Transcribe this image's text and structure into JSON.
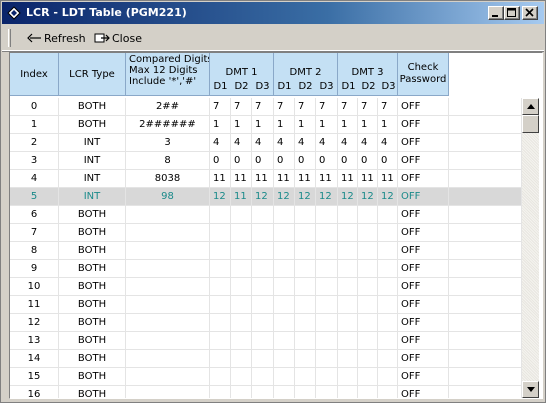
{
  "window": {
    "title": "LCR - LDT Table (PGM221)"
  },
  "toolbar": {
    "refresh_label": "Refresh",
    "refresh_icon": "refresh-arrow-icon",
    "close_label": "Close",
    "close_icon": "close-doc-icon"
  },
  "headers": {
    "index": "Index",
    "lcr_type": "LCR Type",
    "compared_line1": "Compared Digits",
    "compared_line2": "Max 12 Digits",
    "compared_line3": "Include '*','#'",
    "dmt1": "DMT 1",
    "dmt2": "DMT 2",
    "dmt3": "DMT 3",
    "d1": "D1",
    "d2": "D2",
    "d3": "D3",
    "check_line1": "Check",
    "check_line2": "Password"
  },
  "colors": {
    "header_bg": "#c4e0f4",
    "selected_row_bg": "#d8d8d8",
    "selected_row_text": "#1a8a8a",
    "title_gradient_start": "#0a246a"
  },
  "selected_row_index": 5,
  "rows": [
    {
      "index": "0",
      "type": "BOTH",
      "digits": "2##",
      "dmt": [
        "7",
        "7",
        "7",
        "7",
        "7",
        "7",
        "7",
        "7",
        "7"
      ],
      "check": "OFF"
    },
    {
      "index": "1",
      "type": "BOTH",
      "digits": "2######",
      "dmt": [
        "1",
        "1",
        "1",
        "1",
        "1",
        "1",
        "1",
        "1",
        "1"
      ],
      "check": "OFF"
    },
    {
      "index": "2",
      "type": "INT",
      "digits": "3",
      "dmt": [
        "4",
        "4",
        "4",
        "4",
        "4",
        "4",
        "4",
        "4",
        "4"
      ],
      "check": "OFF"
    },
    {
      "index": "3",
      "type": "INT",
      "digits": "8",
      "dmt": [
        "0",
        "0",
        "0",
        "0",
        "0",
        "0",
        "0",
        "0",
        "0"
      ],
      "check": "OFF"
    },
    {
      "index": "4",
      "type": "INT",
      "digits": "8038",
      "dmt": [
        "11",
        "11",
        "11",
        "11",
        "11",
        "11",
        "11",
        "11",
        "11"
      ],
      "check": "OFF"
    },
    {
      "index": "5",
      "type": "INT",
      "digits": "98",
      "dmt": [
        "12",
        "11",
        "12",
        "12",
        "12",
        "12",
        "12",
        "12",
        "12"
      ],
      "check": "OFF"
    },
    {
      "index": "6",
      "type": "BOTH",
      "digits": "",
      "dmt": [
        "",
        "",
        "",
        "",
        "",
        "",
        "",
        "",
        ""
      ],
      "check": "OFF"
    },
    {
      "index": "7",
      "type": "BOTH",
      "digits": "",
      "dmt": [
        "",
        "",
        "",
        "",
        "",
        "",
        "",
        "",
        ""
      ],
      "check": "OFF"
    },
    {
      "index": "8",
      "type": "BOTH",
      "digits": "",
      "dmt": [
        "",
        "",
        "",
        "",
        "",
        "",
        "",
        "",
        ""
      ],
      "check": "OFF"
    },
    {
      "index": "9",
      "type": "BOTH",
      "digits": "",
      "dmt": [
        "",
        "",
        "",
        "",
        "",
        "",
        "",
        "",
        ""
      ],
      "check": "OFF"
    },
    {
      "index": "10",
      "type": "BOTH",
      "digits": "",
      "dmt": [
        "",
        "",
        "",
        "",
        "",
        "",
        "",
        "",
        ""
      ],
      "check": "OFF"
    },
    {
      "index": "11",
      "type": "BOTH",
      "digits": "",
      "dmt": [
        "",
        "",
        "",
        "",
        "",
        "",
        "",
        "",
        ""
      ],
      "check": "OFF"
    },
    {
      "index": "12",
      "type": "BOTH",
      "digits": "",
      "dmt": [
        "",
        "",
        "",
        "",
        "",
        "",
        "",
        "",
        ""
      ],
      "check": "OFF"
    },
    {
      "index": "13",
      "type": "BOTH",
      "digits": "",
      "dmt": [
        "",
        "",
        "",
        "",
        "",
        "",
        "",
        "",
        ""
      ],
      "check": "OFF"
    },
    {
      "index": "14",
      "type": "BOTH",
      "digits": "",
      "dmt": [
        "",
        "",
        "",
        "",
        "",
        "",
        "",
        "",
        ""
      ],
      "check": "OFF"
    },
    {
      "index": "15",
      "type": "BOTH",
      "digits": "",
      "dmt": [
        "",
        "",
        "",
        "",
        "",
        "",
        "",
        "",
        ""
      ],
      "check": "OFF"
    },
    {
      "index": "16",
      "type": "BOTH",
      "digits": "",
      "dmt": [
        "",
        "",
        "",
        "",
        "",
        "",
        "",
        "",
        ""
      ],
      "check": "OFF"
    }
  ]
}
